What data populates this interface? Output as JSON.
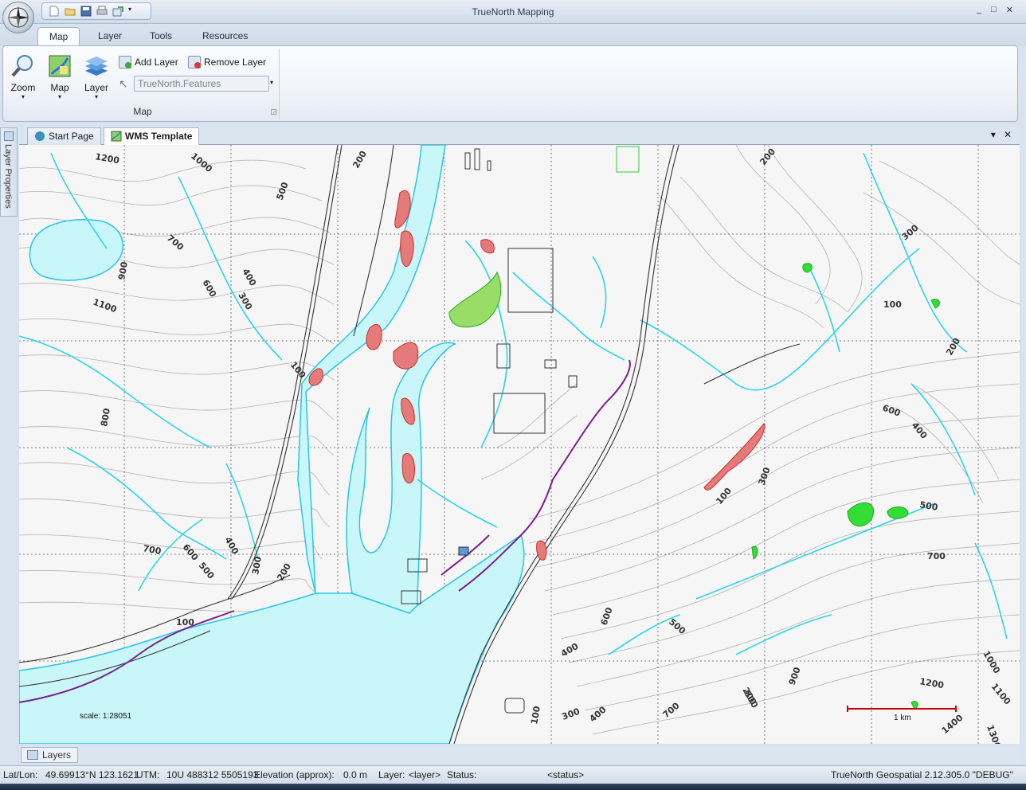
{
  "window": {
    "title": "TrueNorth Mapping",
    "controls": [
      "_",
      "□",
      "✕"
    ]
  },
  "ribbon": {
    "tabs": [
      {
        "label": "Map",
        "active": true
      },
      {
        "label": "Layer",
        "active": false
      },
      {
        "label": "Tools",
        "active": false
      },
      {
        "label": "Resources",
        "active": false
      }
    ],
    "group": {
      "label": "Map",
      "zoom_label": "Zoom",
      "map_label": "Map",
      "layer_label": "Layer",
      "add_layer_label": "Add Layer",
      "remove_layer_label": "Remove Layer",
      "layer_combo_value": "TrueNorth.Features"
    }
  },
  "side_panel": {
    "label": "Layer Properties"
  },
  "document_tabs": [
    {
      "label": "Start Page",
      "active": false,
      "icon": "globe-icon"
    },
    {
      "label": "WMS Template",
      "active": true,
      "icon": "map-icon"
    }
  ],
  "map": {
    "scale_text": "scale: 1:28051",
    "scale_bar_label": "1 km",
    "contour_labels": [
      "1200",
      "1000",
      "200",
      "500",
      "700",
      "600",
      "400",
      "300",
      "900",
      "1100",
      "100",
      "800",
      "700",
      "600",
      "500",
      "400",
      "300",
      "200",
      "100",
      "200",
      "300",
      "100",
      "200",
      "600",
      "400",
      "300",
      "100",
      "500",
      "700",
      "600",
      "500",
      "400",
      "200",
      "1000",
      "1100",
      "1200",
      "900",
      "800",
      "700",
      "1400",
      "1300",
      "300",
      "400",
      "100"
    ],
    "colors": {
      "water": "#c9f6f8",
      "water_edge": "#27c6e6",
      "stream": "#2cd6e6",
      "contour": "#a9a9a9",
      "road": "#333333",
      "wetland_fill": "#e04040",
      "vegetation": "#33dd33",
      "boundary": "#7a1f8c"
    }
  },
  "bottom_tabs": [
    {
      "label": "Layers"
    }
  ],
  "status": {
    "latlon_label": "Lat/Lon:",
    "latlon_value": "49.69913°N 123.1621",
    "utm_label": "UTM:",
    "utm_value": "10U 488312 5505193",
    "elevation_label": "Elevation (approx):",
    "elevation_value": "0.0 m",
    "layer_label": "Layer:",
    "layer_value": "<layer>",
    "status_label": "Status:",
    "status_value": "<status>",
    "version": "TrueNorth Geospatial 2.12.305.0 \"DEBUG\""
  }
}
